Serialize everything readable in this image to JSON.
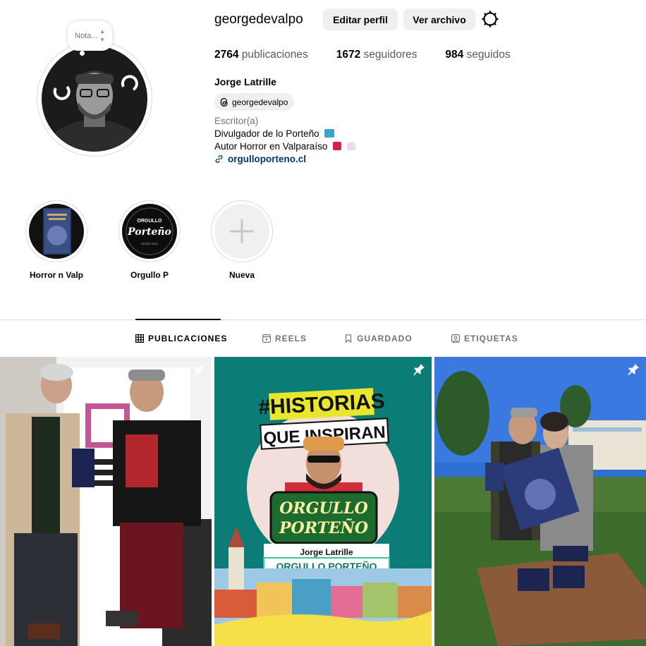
{
  "profile": {
    "username": "georgedevalpo",
    "edit_label": "Editar perfil",
    "archive_label": "Ver archivo",
    "note_placeholder": "Nota...",
    "stats": {
      "posts_count": "2764",
      "posts_label": "publicaciones",
      "followers_count": "1672",
      "followers_label": "seguidores",
      "following_count": "984",
      "following_label": "seguidos"
    },
    "full_name": "Jorge Latrille",
    "threads_handle": "georgedevalpo",
    "category": "Escritor(a)",
    "bio_line1": "Divulgador de lo Porteño",
    "bio_line2": "Autor Horror en Valparaíso",
    "link": "orgulloporteno.cl"
  },
  "highlights": [
    {
      "label": "Horror n Valp"
    },
    {
      "label": "Orgullo P",
      "badge_lines": [
        "ORGULLO",
        "Porteño",
        "DESDE 2023"
      ]
    },
    {
      "label": "Nueva"
    }
  ],
  "tabs": [
    {
      "label": "PUBLICACIONES",
      "active": true
    },
    {
      "label": "REELS",
      "active": false
    },
    {
      "label": "GUARDADO",
      "active": false
    },
    {
      "label": "ETIQUETAS",
      "active": false
    }
  ],
  "posts": {
    "post2": {
      "headline1": "#HISTORIAS",
      "headline2": "QUE INSPIRAN",
      "badge1": "ORGULLO",
      "badge2": "PORTEÑO",
      "name": "Jorge Latrille",
      "subtitle": "ORGULLO PORTEÑO"
    }
  },
  "colors": {
    "link": "#00376b",
    "button_bg": "#efefef",
    "post2_bg": "#0b7d76",
    "headline_yellow": "#e9e72b"
  }
}
